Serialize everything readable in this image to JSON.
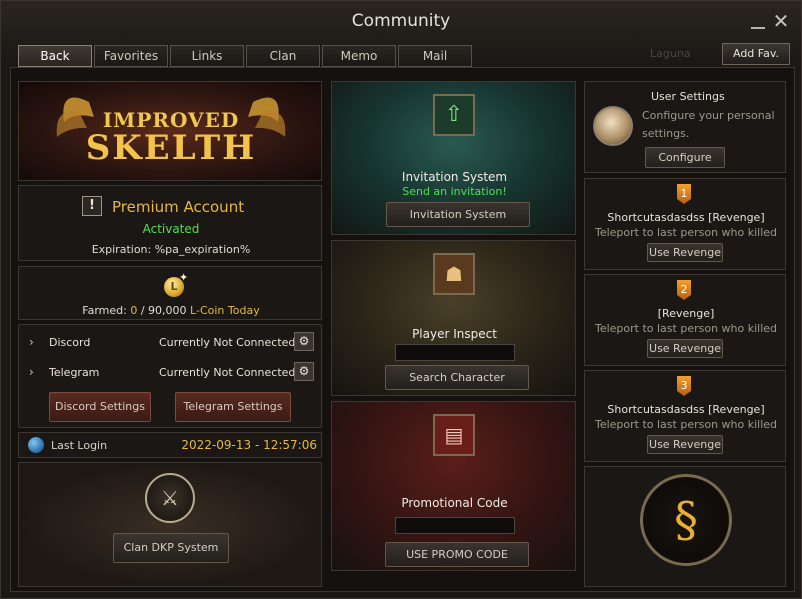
{
  "window": {
    "title": "Community",
    "ghost_text": "Laguna"
  },
  "tabs": [
    {
      "label": "Back",
      "active": true
    },
    {
      "label": "Favorites"
    },
    {
      "label": "Links"
    },
    {
      "label": "Clan"
    },
    {
      "label": "Memo"
    },
    {
      "label": "Mail"
    }
  ],
  "add_fav_label": "Add Fav.",
  "banner": {
    "line1": "IMPROVED",
    "line2": "SKELTH"
  },
  "premium": {
    "title": "Premium Account",
    "status": "Activated",
    "expiration": "Expiration: %pa_expiration%"
  },
  "lcoin": {
    "farmed_label": "Farmed:",
    "farmed_value": "0",
    "farmed_max": " / 90,000",
    "suffix": "L-Coin Today"
  },
  "social": {
    "discord": {
      "label": "Discord",
      "status": "Currently Not Connected"
    },
    "telegram": {
      "label": "Telegram",
      "status": "Currently Not Connected"
    },
    "discord_btn": "Discord Settings",
    "telegram_btn": "Telegram Settings"
  },
  "last_login": {
    "label": "Last Login",
    "value": "2022-09-13 - 12:57:06"
  },
  "clan_dkp": {
    "button": "Clan DKP System"
  },
  "invitation": {
    "title": "Invitation System",
    "subtitle": "Send an invitation!",
    "button": "Invitation System"
  },
  "inspect": {
    "title": "Player Inspect",
    "button": "Search Character"
  },
  "promo": {
    "title": "Promotional Code",
    "button": "USE PROMO CODE"
  },
  "user_settings": {
    "title": "User Settings",
    "desc1": "Configure your personal",
    "desc2": "settings.",
    "button": "Configure"
  },
  "revenge": [
    {
      "rank": "1",
      "title": "Shortcutasdasdss [Revenge]",
      "desc": "Teleport to last person who killed you.",
      "button": "Use Revenge"
    },
    {
      "rank": "2",
      "title": "[Revenge]",
      "desc": "Teleport to last person who killed you.",
      "button": "Use Revenge"
    },
    {
      "rank": "3",
      "title": "Shortcutasdasdss [Revenge]",
      "desc": "Teleport to last person who killed you.",
      "button": "Use Revenge"
    }
  ],
  "colors": {
    "gold": "#e6b93d",
    "green": "#4ee04e",
    "border": "#3d3731"
  }
}
